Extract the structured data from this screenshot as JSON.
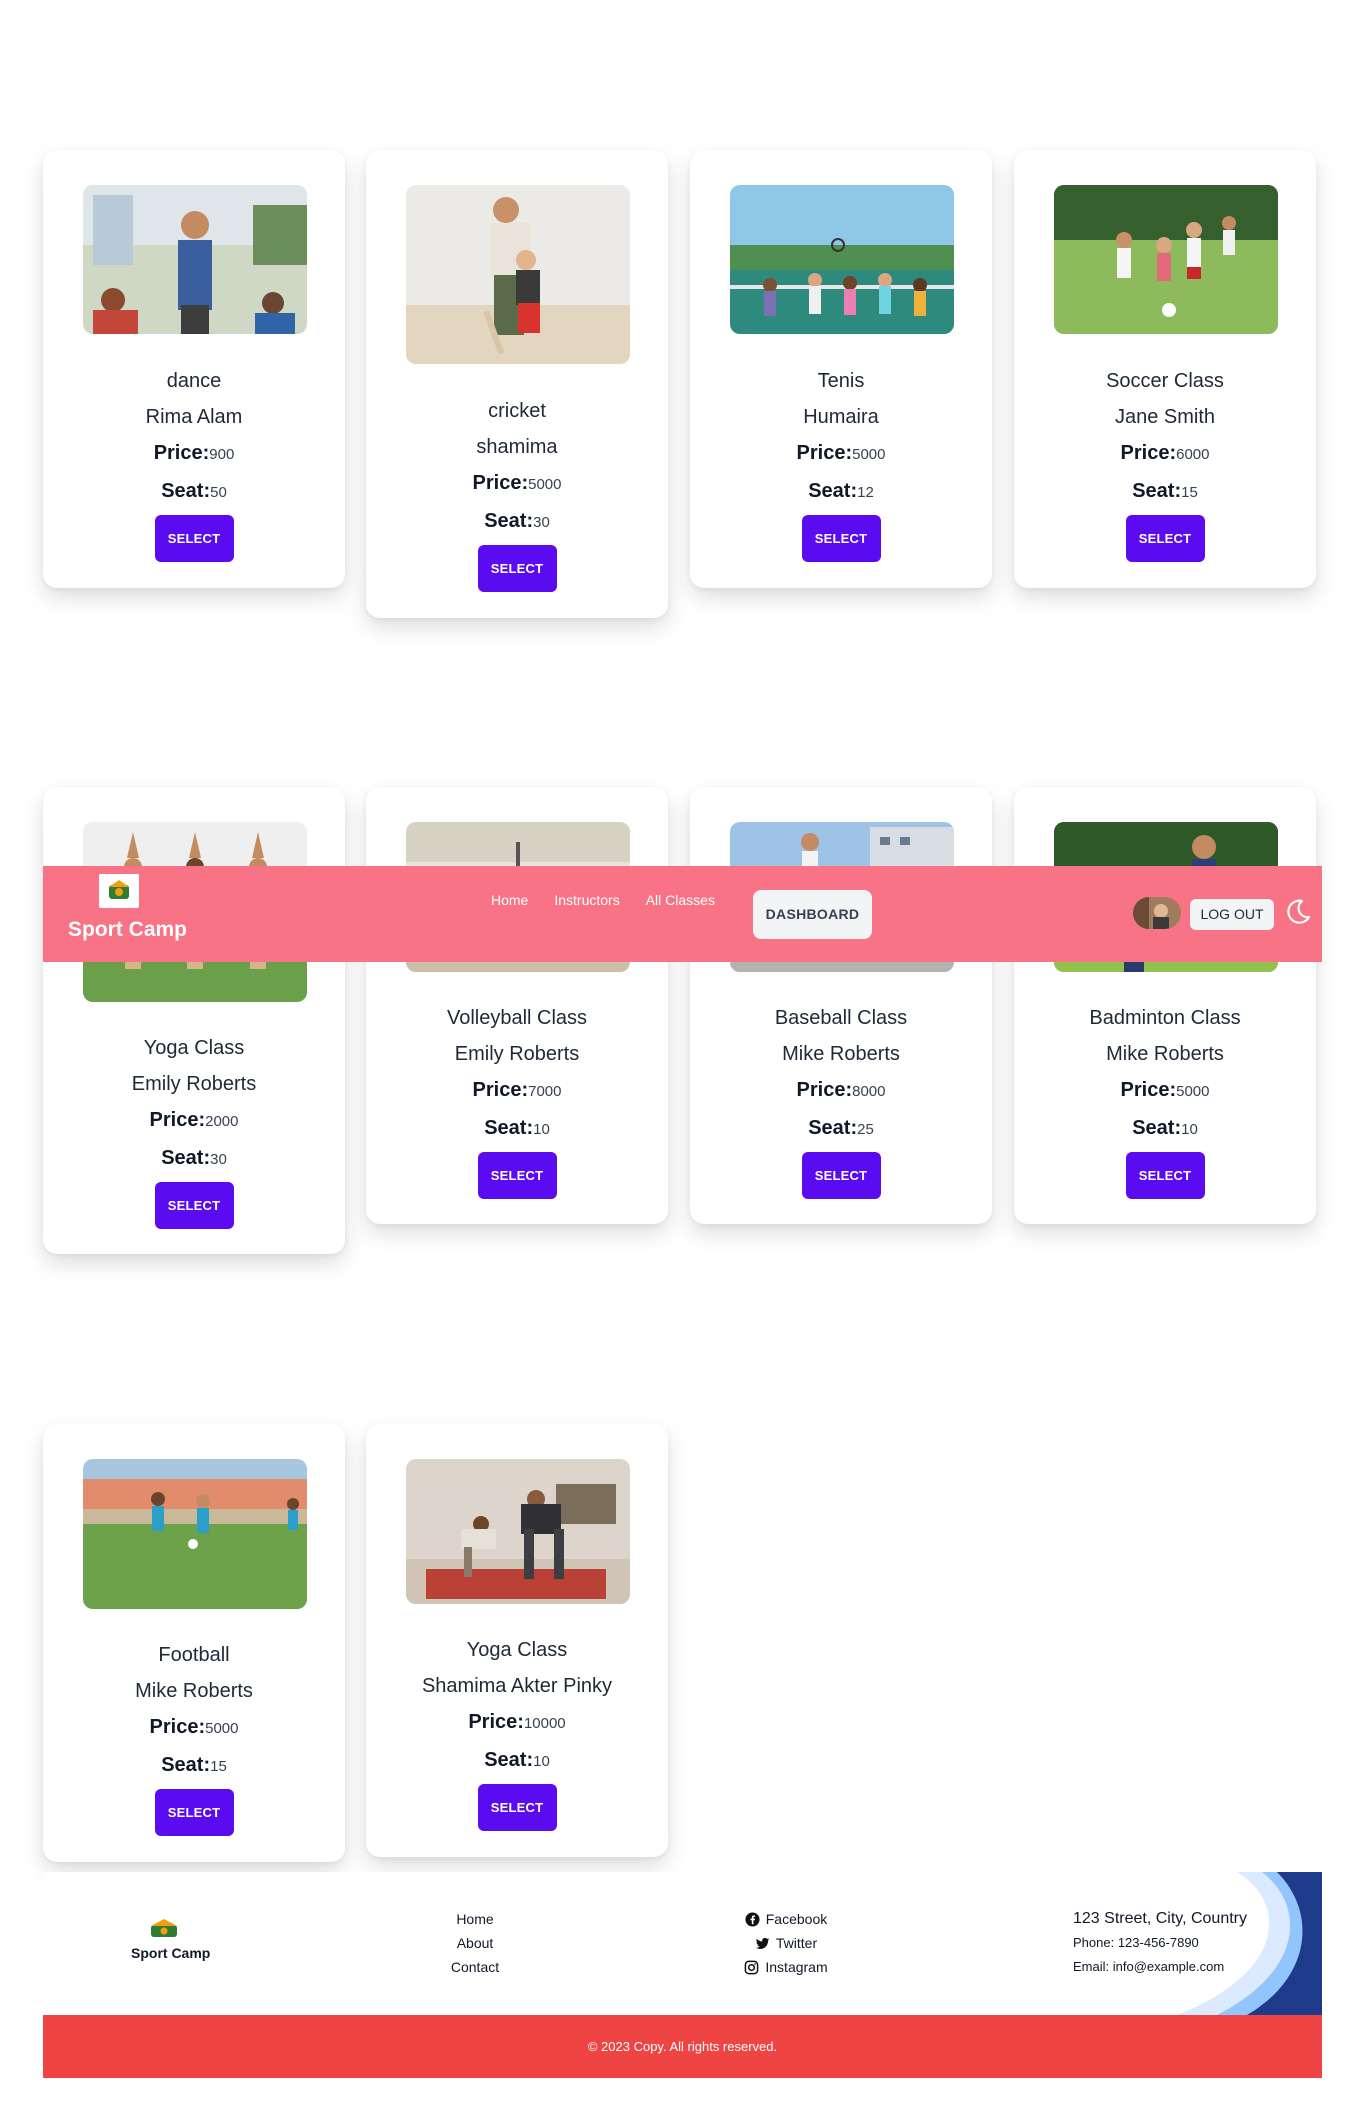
{
  "navbar": {
    "brand": "Sport Camp",
    "links": [
      "Home",
      "Instructors",
      "All Classes"
    ],
    "dashboard_label": "DASHBOARD",
    "logout_label": "LOG OUT",
    "theme_icon": "moon-icon"
  },
  "classes": [
    {
      "title": "dance",
      "instructor": "Rima Alam",
      "price_label": "Price:",
      "price": "900",
      "seat_label": "Seat:",
      "seats": "50",
      "button": "SELECT"
    },
    {
      "title": "cricket",
      "instructor": "shamima",
      "price_label": "Price:",
      "price": "5000",
      "seat_label": "Seat:",
      "seats": "30",
      "button": "SELECT"
    },
    {
      "title": "Tenis",
      "instructor": "Humaira",
      "price_label": "Price:",
      "price": "5000",
      "seat_label": "Seat:",
      "seats": "12",
      "button": "SELECT"
    },
    {
      "title": "Soccer Class",
      "instructor": "Jane Smith",
      "price_label": "Price:",
      "price": "6000",
      "seat_label": "Seat:",
      "seats": "15",
      "button": "SELECT"
    },
    {
      "title": "Yoga Class",
      "instructor": "Emily Roberts",
      "price_label": "Price:",
      "price": "2000",
      "seat_label": "Seat:",
      "seats": "30",
      "button": "SELECT"
    },
    {
      "title": "Volleyball Class",
      "instructor": "Emily Roberts",
      "price_label": "Price:",
      "price": "7000",
      "seat_label": "Seat:",
      "seats": "10",
      "button": "SELECT"
    },
    {
      "title": "Baseball Class",
      "instructor": "Mike Roberts",
      "price_label": "Price:",
      "price": "8000",
      "seat_label": "Seat:",
      "seats": "25",
      "button": "SELECT"
    },
    {
      "title": "Badminton Class",
      "instructor": "Mike Roberts",
      "price_label": "Price:",
      "price": "5000",
      "seat_label": "Seat:",
      "seats": "10",
      "button": "SELECT"
    },
    {
      "title": "Football",
      "instructor": "Mike Roberts",
      "price_label": "Price:",
      "price": "5000",
      "seat_label": "Seat:",
      "seats": "15",
      "button": "SELECT"
    },
    {
      "title": "Yoga Class",
      "instructor": "Shamima Akter Pinky",
      "price_label": "Price:",
      "price": "10000",
      "seat_label": "Seat:",
      "seats": "10",
      "button": "SELECT"
    }
  ],
  "footer": {
    "brand": "Sport Camp",
    "links": [
      "Home",
      "About",
      "Contact"
    ],
    "social": [
      {
        "label": "Facebook",
        "icon": "facebook-icon"
      },
      {
        "label": "Twitter",
        "icon": "twitter-icon"
      },
      {
        "label": "Instagram",
        "icon": "instagram-icon"
      }
    ],
    "address": "123 Street, City, Country",
    "phone": "Phone: 123-456-7890",
    "email": "Email: info@example.com",
    "copyright": "© 2023 Copy. All rights reserved."
  },
  "colors": {
    "navbar_bg": "#f87385",
    "button_bg": "#5b0bef",
    "copyright_bg": "#ef4444"
  }
}
